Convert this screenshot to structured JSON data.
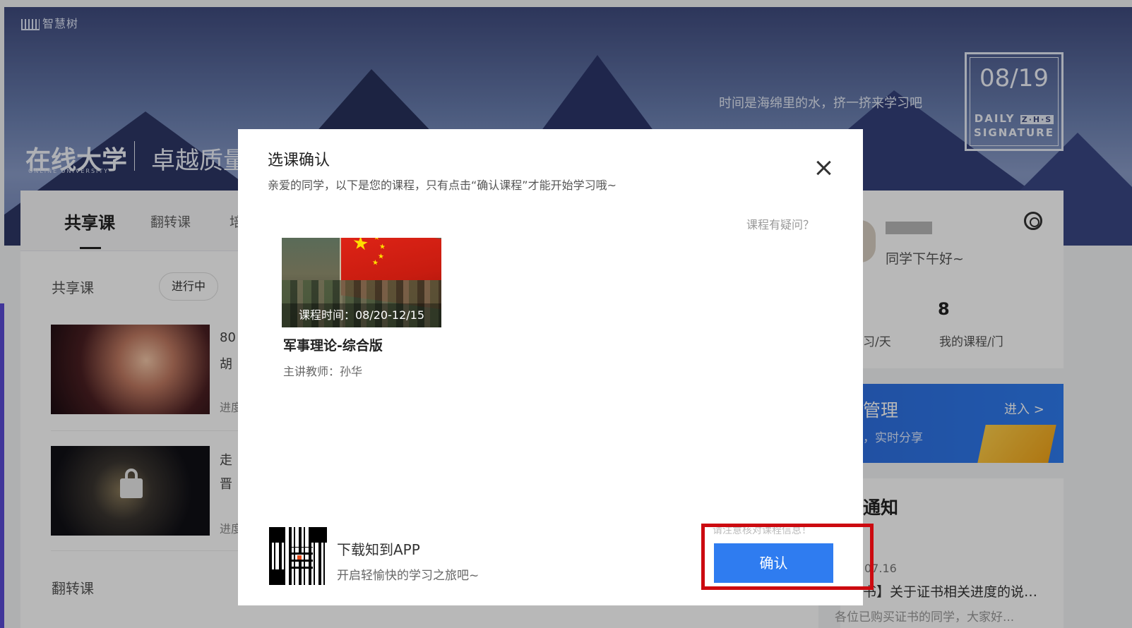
{
  "header": {
    "logo_text": "智慧树",
    "univ_title": "在线大学",
    "univ_sub": "ONLINE UNIVERSITY",
    "quality_title": "卓越质量",
    "motto": "时间是海绵里的水，挤一挤来学习吧",
    "date": "08/19",
    "daily_line1": "DAILY",
    "daily_zhs": "Z·H·S",
    "daily_line2": "SIGNATURE"
  },
  "tabs": [
    {
      "label": "共享课",
      "active": true
    },
    {
      "label": "翻转课",
      "active": false
    },
    {
      "label": "培",
      "active": false
    }
  ],
  "main": {
    "section_label": "共享课",
    "status_pill": "进行中",
    "course1_frag_a": "80",
    "course1_frag_b": "胡",
    "course1_frag_c": "进度",
    "course2_frag_a": "走",
    "course2_frag_b": "晋",
    "course2_frag_c": "进度",
    "bottom_section": "翻转课"
  },
  "sidebar": {
    "greeting": "同学下午好~",
    "stat_num": "8",
    "stat_label": "我的课程/门",
    "stat_frag": "习/天",
    "mgmt_title": "管理",
    "mgmt_enter": "进入 >",
    "mgmt_sub": "，实时分享",
    "notice_title": "通知",
    "notice_date": "07.16",
    "notice_text": "书】关于证书相关进度的说…",
    "notice_more": "各位已购买证书的同学，大家好..."
  },
  "modal": {
    "title": "选课确认",
    "subtitle": "亲爱的同学，以下是您的课程，只有点击“确认课程”才能开始学习哦~",
    "question_link": "课程有疑问？",
    "course": {
      "time": "课程时间：08/20-12/15",
      "name": "军事理论-综合版",
      "teacher": "主讲教师：孙华"
    },
    "app_title": "下载知到APP",
    "app_sub": "开启轻愉快的学习之旅吧~",
    "verify_note": "请注意核对课程信息！",
    "confirm_label": "确认"
  },
  "colors": {
    "accent": "#2f7cf0",
    "highlight": "#cc0a10"
  }
}
